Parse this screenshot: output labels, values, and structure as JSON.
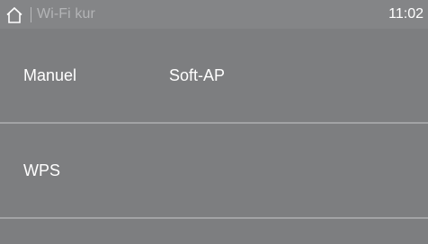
{
  "status_bar": {
    "home_icon": "home-icon",
    "title": "Wi-Fi kur",
    "time": "11:02"
  },
  "menu": {
    "items": [
      {
        "label": "Manuel"
      },
      {
        "label": "Soft-AP"
      },
      {
        "label": "WPS"
      }
    ]
  },
  "colors": {
    "background": "#7d7e80",
    "status_bar": "#848587",
    "title_text": "#b3b4b6",
    "text": "#ffffff",
    "separator": "#a2a3a5"
  }
}
